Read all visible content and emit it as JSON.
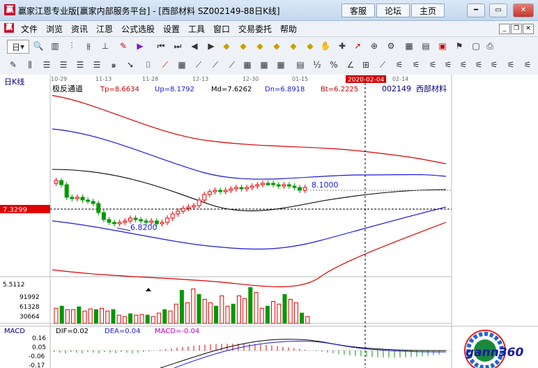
{
  "titlebar": {
    "app_icon_char": "赢",
    "title": "赢家江恩专业版[赢家内部服务平台] - [西部材料   SZ002149-88日K线]",
    "links": [
      "客服",
      "论坛",
      "主页"
    ]
  },
  "menubar": {
    "items": [
      "文件",
      "浏览",
      "资讯",
      "江恩",
      "公式选股",
      "设置",
      "工具",
      "窗口",
      "交易委托",
      "帮助"
    ]
  },
  "toolbar": {
    "period_label": "日"
  },
  "chart": {
    "period_label": "日K线",
    "indicator_name": "极反通道",
    "tp": "Tp=8.6634",
    "up": "Up=8.1792",
    "md": "Md=7.6262",
    "dn": "Dn=6.8918",
    "bt": "Bt=6.2225",
    "stock_code": "002149",
    "stock_name": "西部材料",
    "date_ticks": [
      "10-29",
      "11-13",
      "11-28",
      "12-13",
      "12-30",
      "01-15",
      "02-14"
    ],
    "highlight_date": "2020-02-04",
    "price_marker": "7.3299",
    "high_label": "8.1000",
    "low_label": "6.8200",
    "vol_axis": [
      "5.5112",
      "91992",
      "61328",
      "30664"
    ],
    "colors": {
      "up": "#e00000",
      "down": "#009900",
      "upper_band": "#dd0000",
      "mid_band": "#1a1ae0",
      "center_band": "#000000"
    }
  },
  "macd": {
    "label": "MACD",
    "dif": "DIF=0.02",
    "dea": "DEA=0.04",
    "macd": "MACD=-0.04",
    "axis": [
      "0.16",
      "0.05",
      "-0.06",
      "-0.17"
    ]
  },
  "logo": {
    "text": "gann360"
  }
}
